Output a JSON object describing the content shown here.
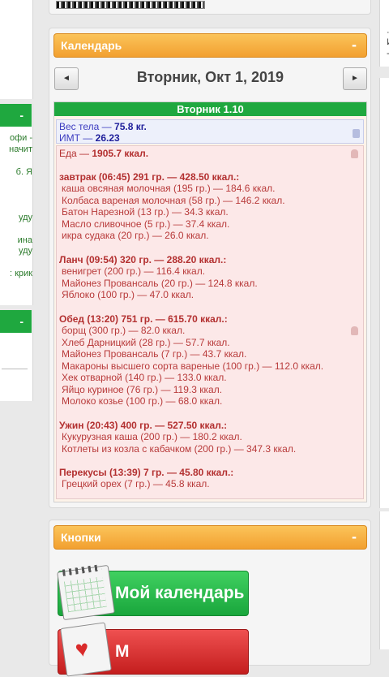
{
  "left": {
    "snippets": [
      "офи -",
      "начит",
      "б. Я",
      "уду",
      "ина",
      "уду",
      ": крик"
    ],
    "header1_label": "-",
    "header2_label": "-"
  },
  "right": {
    "snippets": [
      "·",
      "И",
      "-"
    ]
  },
  "calendar": {
    "header": "Календарь",
    "collapse_label": "-",
    "prev_label": "◄",
    "next_label": "►",
    "date_title": "Вторник, Окт 1, 2019",
    "day_label": "Вторник 1.10",
    "weight_prefix": "Вес тела —",
    "weight_value": "75.8 кг.",
    "bmi_prefix": "ИМТ —",
    "bmi_value": "26.23",
    "food_prefix": "Еда —",
    "food_total": "1905.7 ккал.",
    "meals": [
      {
        "title": "завтрак (06:45) 291 гр. — 428.50 ккал.:",
        "items": [
          "каша овсяная молочная (195 гр.) — 184.6 ккал.",
          "Колбаса вареная молочная (58 гр.) — 146.2 ккал.",
          "Батон Нарезной (13 гр.) — 34.3 ккал.",
          "Масло сливочное (5 гр.) — 37.4 ккал.",
          "икра судака (20 гр.) — 26.0 ккал."
        ]
      },
      {
        "title": "Ланч (09:54) 320 гр. — 288.20 ккал.:",
        "items": [
          "венигрет (200 гр.) — 116.4 ккал.",
          "Майонез Провансаль (20 гр.) — 124.8 ккал.",
          "Яблоко (100 гр.) — 47.0 ккал."
        ]
      },
      {
        "title": "Обед (13:20) 751 гр. — 615.70 ккал.:",
        "items": [
          "борщ (300 гр.) — 82.0 ккал.",
          "Хлеб Дарницкий (28 гр.) — 57.7 ккал.",
          "Майонез Провансаль (7 гр.) — 43.7 ккал.",
          "Макароны высшего сорта вареные (100 гр.) — 112.0 ккал.",
          "Хек отварной (140 гр.) — 133.0 ккал.",
          "Яйцо куриное (76 гр.) — 119.3 ккал.",
          "Молоко козье (100 гр.) — 68.0 ккал."
        ]
      },
      {
        "title": "Ужин (20:43) 400 гр. — 527.50 ккал.:",
        "items": [
          "Кукурузная каша (200 гр.) — 180.2 ккал.",
          "Котлеты из козла с кабачком (200 гр.) — 347.3 ккал."
        ]
      },
      {
        "title": "Перекусы (13:39) 7 гр. — 45.80 ккал.:",
        "items": [
          "Грецкий орех (7 гр.) — 45.8 ккал."
        ]
      }
    ]
  },
  "buttons_panel": {
    "header": "Кнопки",
    "collapse_label": "-",
    "my_calendar_label": "Мой календарь",
    "second_label": "М"
  },
  "colors": {
    "accent_orange": "#f2a030",
    "day_bar_green": "#1fa83f",
    "food_red": "#b33030",
    "weight_blue": "#1e1e9a"
  }
}
